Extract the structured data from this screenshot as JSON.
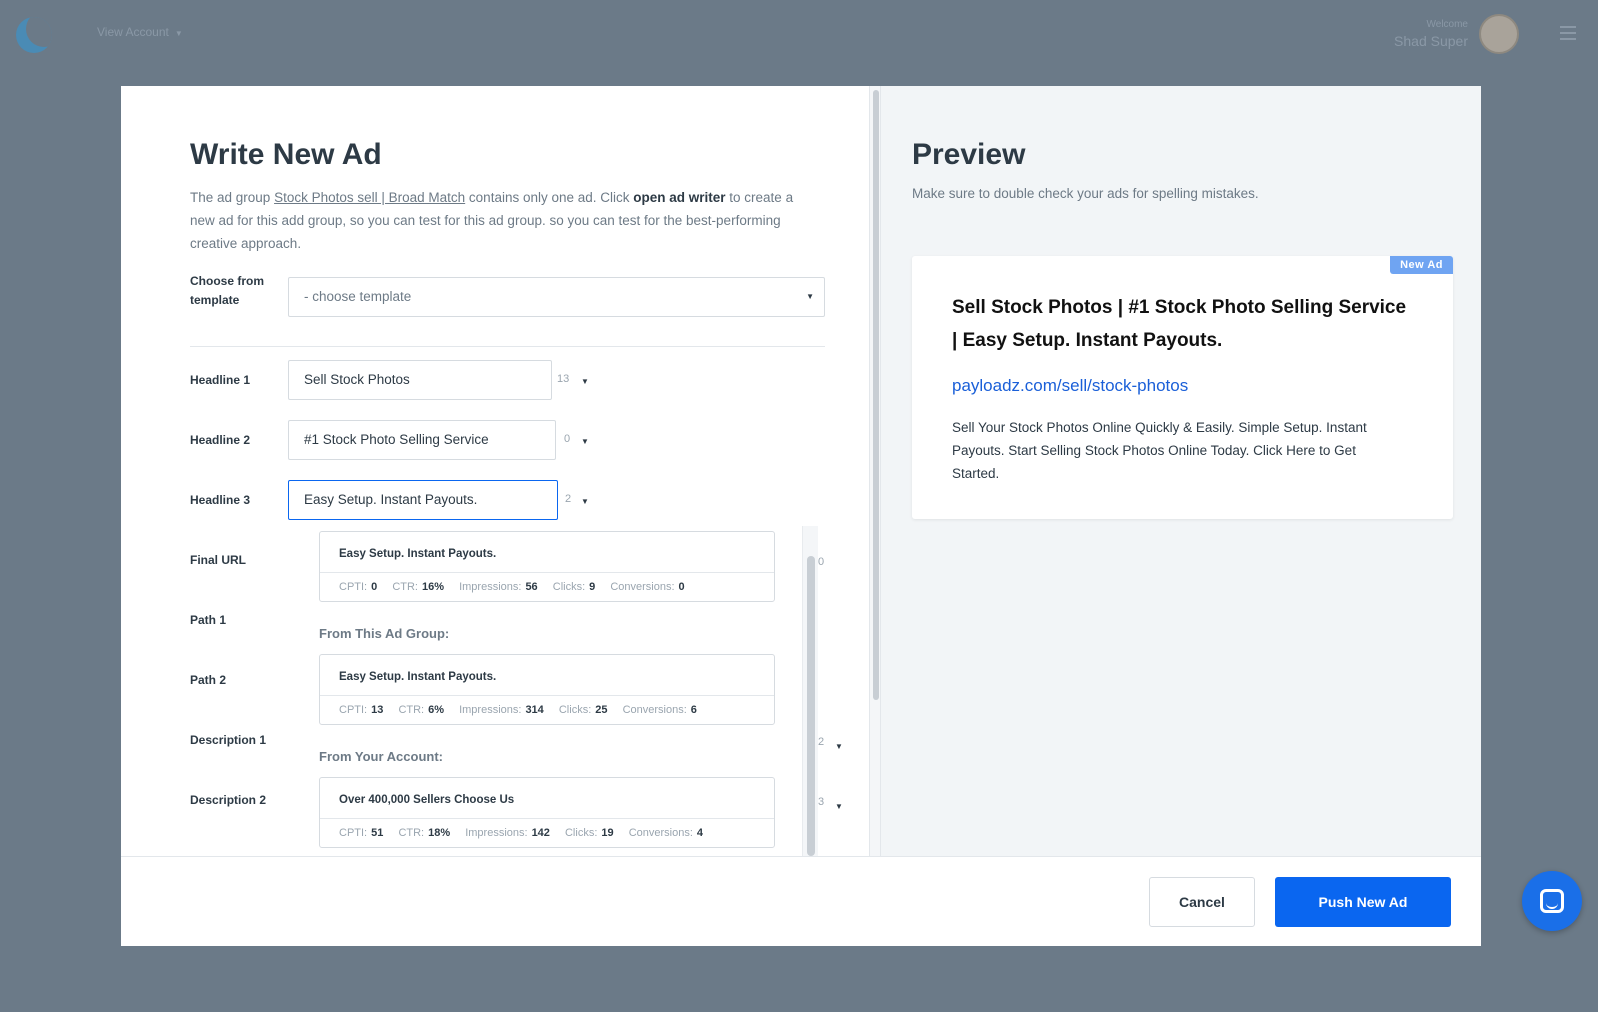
{
  "topbar": {
    "account_label": "View Account",
    "welcome_label": "Welcome",
    "user_name": "Shad Super"
  },
  "form": {
    "title": "Write New Ad",
    "intro_prefix": "The ad group ",
    "intro_link": "Stock Photos sell | Broad Match",
    "intro_mid": " contains only one ad. Click ",
    "intro_bold": "open ad writer",
    "intro_suffix": " to create a new ad for this add group, so you can test for this ad group. so you can test for the best-performing creative approach.",
    "template_label": "Choose from template",
    "template_placeholder": "- choose template",
    "headline1_label": "Headline 1",
    "headline1_value": "Sell Stock Photos",
    "headline1_count": "13",
    "headline2_label": "Headline 2",
    "headline2_value": "#1 Stock Photo Selling Service",
    "headline2_count": "0",
    "headline3_label": "Headline 3",
    "headline3_value": "Easy Setup. Instant Payouts.",
    "headline3_count": "2",
    "final_url_label": "Final URL",
    "final_url_count": "0",
    "path1_label": "Path 1",
    "path2_label": "Path 2",
    "description1_label": "Description 1",
    "description1_count": "2",
    "description2_label": "Description 2",
    "description2_count": "3"
  },
  "suggestions": {
    "stat_labels": {
      "cpti": "CPTI:",
      "ctr": "CTR:",
      "impressions": "Impressions:",
      "clicks": "Clicks:",
      "conversions": "Conversions:"
    },
    "current": {
      "title": "Easy Setup. Instant Payouts.",
      "cpti": "0",
      "ctr": "16%",
      "impressions": "56",
      "clicks": "9",
      "conversions": "0"
    },
    "group_ad_group": "From This Ad Group:",
    "ad_group": {
      "title": "Easy Setup. Instant Payouts.",
      "cpti": "13",
      "ctr": "6%",
      "impressions": "314",
      "clicks": "25",
      "conversions": "6"
    },
    "group_account": "From Your Account:",
    "account": {
      "title": "Over 400,000 Sellers Choose Us",
      "cpti": "51",
      "ctr": "18%",
      "impressions": "142",
      "clicks": "19",
      "conversions": "4"
    }
  },
  "preview": {
    "title": "Preview",
    "subtitle": "Make sure to double check your ads for spelling mistakes.",
    "badge": "New Ad",
    "headline": "Sell Stock Photos | #1 Stock Photo Selling Service | Easy Setup. Instant Payouts.",
    "url": "payloadz.com/sell/stock-photos",
    "description": "Sell Your Stock Photos Online Quickly & Easily. Simple Setup. Instant Payouts. Start Selling Stock Photos Online Today. Click Here to Get Started."
  },
  "footer": {
    "cancel_label": "Cancel",
    "push_label": "Push New Ad"
  },
  "colors": {
    "accent": "#0a66f0",
    "link": "#1a5fd8",
    "badge": "#6fa4f2"
  },
  "icons": [
    "logo-icon",
    "chevron-down-icon",
    "avatar",
    "menu-icon",
    "chat-icon"
  ]
}
